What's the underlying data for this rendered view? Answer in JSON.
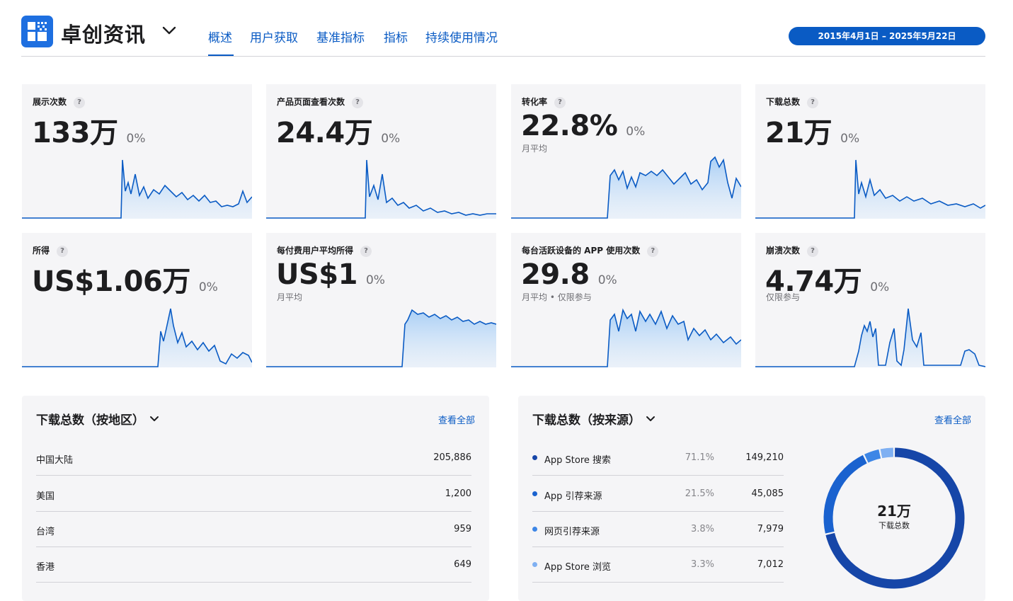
{
  "header": {
    "app_name": "卓创资讯",
    "tabs": [
      {
        "label": "概述",
        "active": true
      },
      {
        "label": "用户获取",
        "active": false
      },
      {
        "label": "基准指标",
        "active": false
      },
      {
        "label": "指标",
        "active": false
      },
      {
        "label": "持续使用情况",
        "active": false
      }
    ],
    "date_range": "2015年4月1日 – 2025年5月22日",
    "accent_color": "#0a5bc4"
  },
  "metrics": [
    {
      "label": "展示次数",
      "value": "133万",
      "delta": "0%",
      "sub": ""
    },
    {
      "label": "产品页面查看次数",
      "value": "24.4万",
      "delta": "0%",
      "sub": ""
    },
    {
      "label": "转化率",
      "value": "22.8%",
      "delta": "0%",
      "sub": "月平均"
    },
    {
      "label": "下载总数",
      "value": "21万",
      "delta": "0%",
      "sub": ""
    },
    {
      "label": "所得",
      "value": "US$1.06万",
      "delta": "0%",
      "sub": ""
    },
    {
      "label": "每付费用户平均所得",
      "value": "US$1",
      "delta": "0%",
      "sub": "月平均"
    },
    {
      "label": "每台活跃设备的 APP 使用次数",
      "value": "29.8",
      "delta": "0%",
      "sub": "月平均 • 仅限参与"
    },
    {
      "label": "崩溃次数",
      "value": "4.74万",
      "delta": "0%",
      "sub": "仅限参与"
    }
  ],
  "help_glyph": "?",
  "by_region": {
    "title": "下载总数（按地区）",
    "view_all": "查看全部",
    "rows": [
      {
        "name": "中国大陆",
        "value": "205,886"
      },
      {
        "name": "美国",
        "value": "1,200"
      },
      {
        "name": "台湾",
        "value": "959"
      },
      {
        "name": "香港",
        "value": "649"
      }
    ]
  },
  "by_source": {
    "title": "下载总数（按来源）",
    "view_all": "查看全部",
    "rows": [
      {
        "name": "App Store 搜索",
        "pct": "71.1%",
        "value": "149,210",
        "color": "#1646a8",
        "share": 71.1
      },
      {
        "name": "App 引荐来源",
        "pct": "21.5%",
        "value": "45,085",
        "color": "#1a62cf",
        "share": 21.5
      },
      {
        "name": "网页引荐来源",
        "pct": "3.8%",
        "value": "7,979",
        "color": "#3d86e6",
        "share": 3.8
      },
      {
        "name": "App Store 浏览",
        "pct": "3.3%",
        "value": "7,012",
        "color": "#7fb0f2",
        "share": 3.3
      }
    ],
    "donut_value": "21万",
    "donut_label": "下载总数"
  }
}
